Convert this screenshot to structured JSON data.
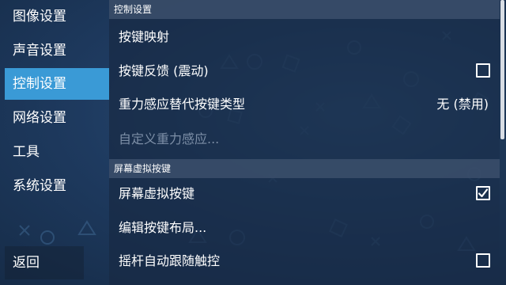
{
  "sidebar": {
    "items": [
      {
        "label": "图像设置",
        "active": false
      },
      {
        "label": "声音设置",
        "active": false
      },
      {
        "label": "控制设置",
        "active": true
      },
      {
        "label": "网络设置",
        "active": false
      },
      {
        "label": "工具",
        "active": false
      },
      {
        "label": "系统设置",
        "active": false
      }
    ],
    "back_label": "返回"
  },
  "sections": {
    "control": {
      "header": "控制设置",
      "rows": {
        "key_mapping": {
          "label": "按键映射"
        },
        "haptic": {
          "label": "按键反馈 (震动)",
          "checked": false
        },
        "tilt_type": {
          "label": "重力感应替代按键类型",
          "value": "无 (禁用)"
        },
        "tilt_custom": {
          "label": "自定义重力感应...",
          "disabled": true
        }
      }
    },
    "touch": {
      "header": "屏幕虚拟按键",
      "rows": {
        "show_touch": {
          "label": "屏幕虚拟按键",
          "checked": true
        },
        "edit_layout": {
          "label": "编辑按键布局..."
        },
        "joystick_follow": {
          "label": "摇杆自动跟随触控",
          "checked": false
        }
      }
    }
  },
  "colors": {
    "accent": "#3a9ad6",
    "background": "#1e3a5f",
    "disabled_text": "#7c8ea6"
  }
}
